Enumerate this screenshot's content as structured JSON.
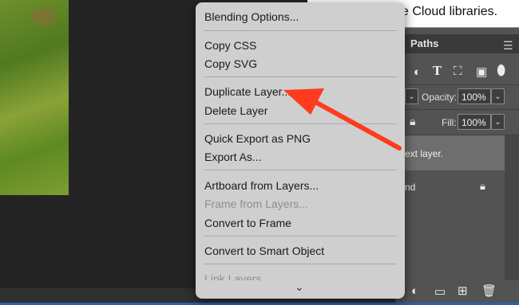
{
  "banner": {
    "text": "ve Cloud libraries."
  },
  "layers_panel": {
    "tab": "Paths",
    "opacity_label": "Opacity:",
    "opacity_value": "100%",
    "fill_label": "Fill:",
    "fill_value": "100%",
    "layer_text": "ext layer.",
    "background_text": "nd"
  },
  "context_menu": {
    "items": [
      {
        "label": "Blending Options..."
      },
      {
        "label": "Copy CSS"
      },
      {
        "label": "Copy SVG"
      },
      {
        "label": "Duplicate Layer..."
      },
      {
        "label": "Delete Layer"
      },
      {
        "label": "Quick Export as PNG"
      },
      {
        "label": "Export As..."
      },
      {
        "label": "Artboard from Layers..."
      },
      {
        "label": "Frame from Layers...",
        "disabled": true
      },
      {
        "label": "Convert to Frame"
      },
      {
        "label": "Convert to Smart Object"
      },
      {
        "label": "Link Layers",
        "disabled": true
      }
    ],
    "more": "⌄"
  },
  "annotation": {
    "color": "#ff3b1f",
    "target": "Duplicate Layer..."
  }
}
